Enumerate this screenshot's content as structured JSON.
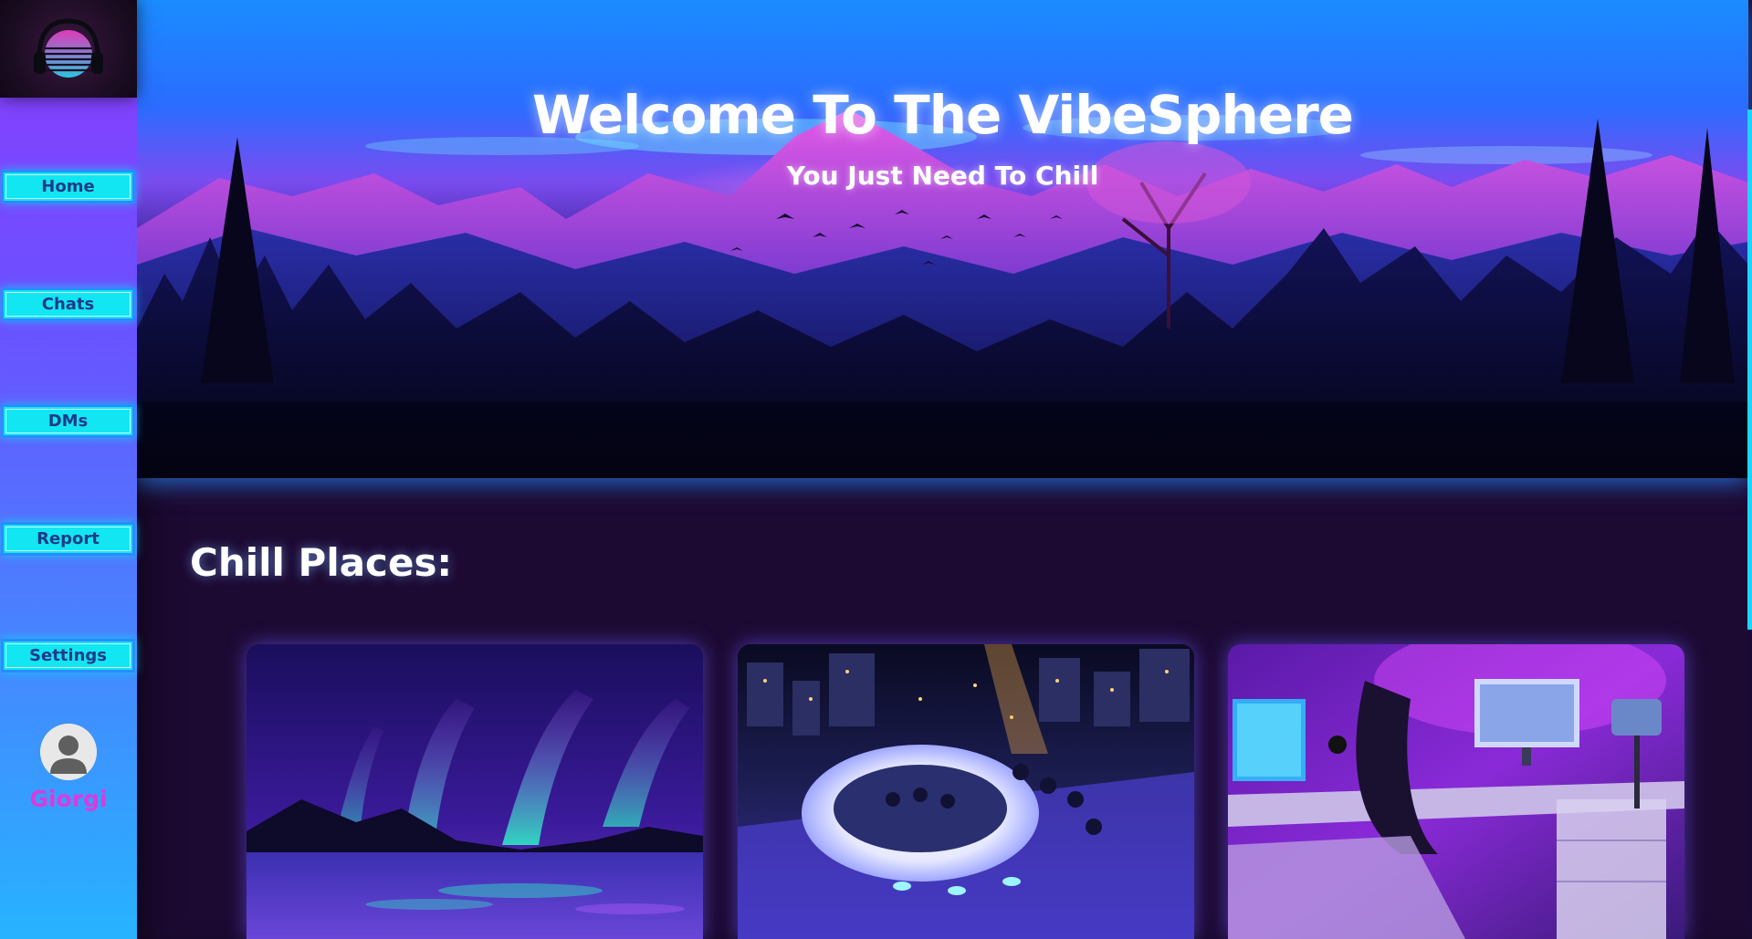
{
  "hero": {
    "title": "Welcome To The VibeSphere",
    "subtitle": "You Just Need To Chill"
  },
  "sidebar": {
    "logo_icon": "headphones-sunset-logo",
    "items": [
      {
        "label": "Home"
      },
      {
        "label": "Chats"
      },
      {
        "label": "DMs"
      },
      {
        "label": "Report"
      },
      {
        "label": "Settings"
      }
    ],
    "user": {
      "name": "Giorgi",
      "avatar_icon": "user-avatar-icon"
    }
  },
  "main": {
    "section_title": "Chill Places:",
    "places": [
      {
        "image": "aurora-lake-image"
      },
      {
        "image": "rooftop-bar-image"
      },
      {
        "image": "gaming-room-image"
      }
    ]
  },
  "colors": {
    "accent_cyan": "#12e6f2",
    "nav_text": "#1e3a8a",
    "username": "#d93bdc",
    "background": "#1d0a33"
  }
}
